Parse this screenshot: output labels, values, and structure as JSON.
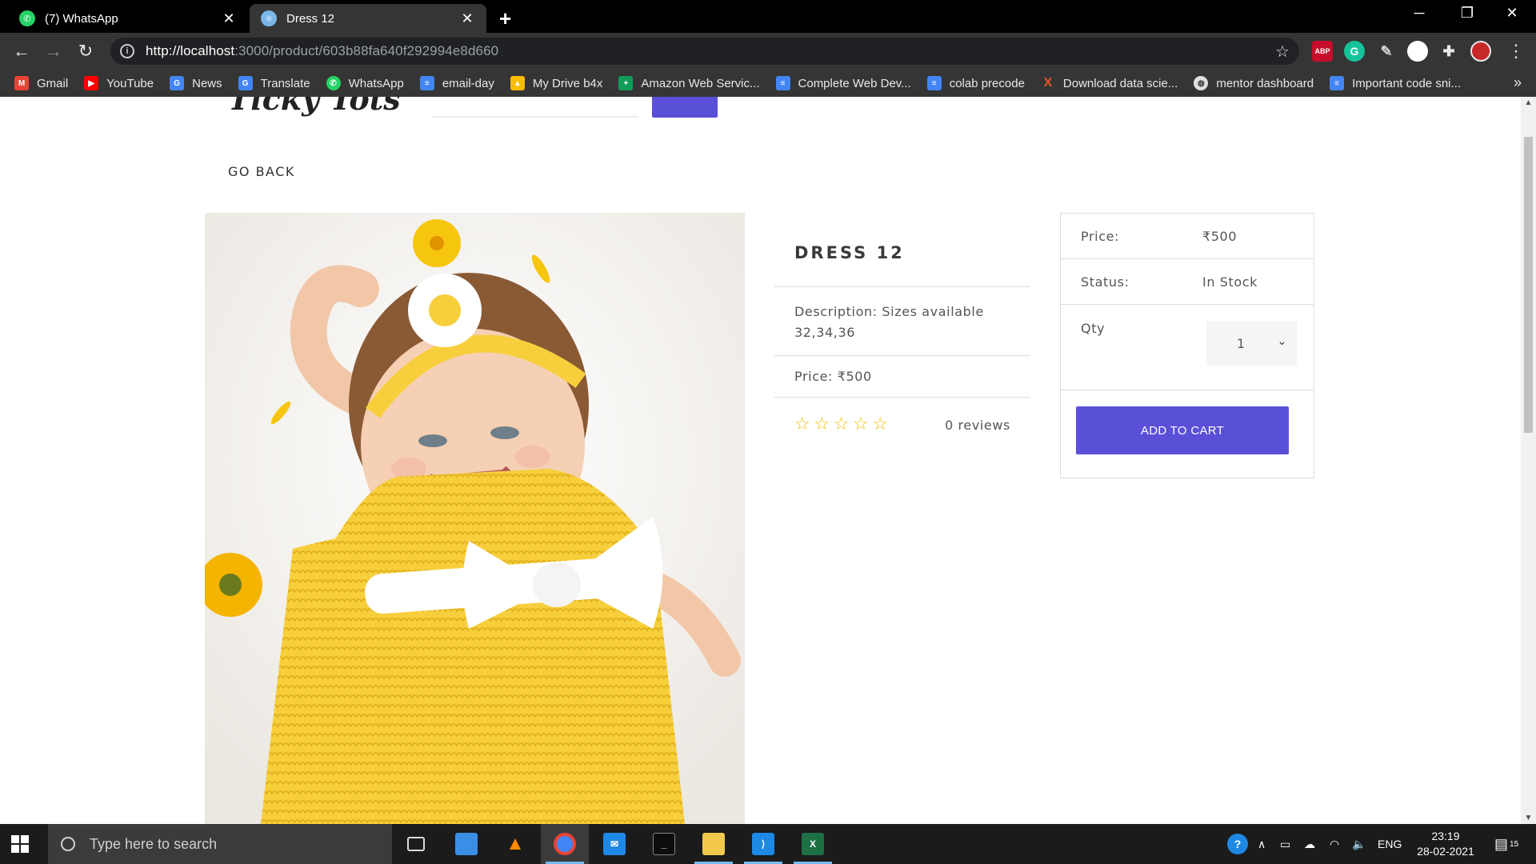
{
  "browser": {
    "tabs": [
      {
        "title": "(7) WhatsApp",
        "active": false,
        "icon": "whatsapp-icon"
      },
      {
        "title": "Dress 12",
        "active": true,
        "icon": "react-icon"
      }
    ],
    "url_host": "http://localhost",
    "url_rest": ":3000/product/603b88fa640f292994e8d660",
    "bookmarks": [
      {
        "label": "Gmail",
        "icon": "gmail-icon",
        "color": "#ea4335"
      },
      {
        "label": "YouTube",
        "icon": "youtube-icon",
        "color": "#ff0000"
      },
      {
        "label": "News",
        "icon": "news-icon",
        "color": "#4285f4"
      },
      {
        "label": "Translate",
        "icon": "translate-icon",
        "color": "#4285f4"
      },
      {
        "label": "WhatsApp",
        "icon": "whatsapp-icon",
        "color": "#25d366"
      },
      {
        "label": "email-day",
        "icon": "docs-icon",
        "color": "#4285f4"
      },
      {
        "label": "My Drive b4x",
        "icon": "drive-icon",
        "color": "#fbbc04"
      },
      {
        "label": "Amazon Web Servic...",
        "icon": "sheets-icon",
        "color": "#0f9d58"
      },
      {
        "label": "Complete Web Dev...",
        "icon": "docs-icon",
        "color": "#4285f4"
      },
      {
        "label": "colab precode",
        "icon": "docs-icon",
        "color": "#4285f4"
      },
      {
        "label": "Download data scie...",
        "icon": "x-icon",
        "color": "#e8532a"
      },
      {
        "label": "mentor dashboard",
        "icon": "globe-icon",
        "color": "#9e9e9e"
      },
      {
        "label": "Important code sni...",
        "icon": "docs-icon",
        "color": "#4285f4"
      }
    ],
    "bookmarks_more": "»",
    "extensions": [
      {
        "name": "adblock-icon",
        "text": "ABP",
        "color": "#c70d2c"
      },
      {
        "name": "grammarly-icon",
        "text": "G",
        "color": "#15c39a"
      },
      {
        "name": "color-picker-icon",
        "text": "",
        "color": "#9c27b0"
      },
      {
        "name": "profile-avatar-icon",
        "text": "",
        "color": "#ffffff"
      },
      {
        "name": "extensions-puzzle-icon",
        "text": "",
        "color": "#353535"
      },
      {
        "name": "account-avatar-icon",
        "text": "",
        "color": "#c62828"
      }
    ]
  },
  "site": {
    "brand": "Ticky Tots",
    "go_back": "GO BACK"
  },
  "product": {
    "name": "DRESS 12",
    "description": "Description: Sizes available 32,34,36",
    "price_line": "Price: ₹500",
    "reviews": "0 reviews",
    "rating": 0,
    "stars": [
      "☆",
      "☆",
      "☆",
      "☆",
      "☆"
    ]
  },
  "cart_card": {
    "price_label": "Price:",
    "price_value": "₹500",
    "status_label": "Status:",
    "status_value": "In Stock",
    "qty_label": "Qty",
    "qty_value": "1",
    "add_to_cart": "ADD TO CART"
  },
  "taskbar": {
    "search_placeholder": "Type here to search",
    "language": "ENG",
    "time": "23:19",
    "date": "28-02-2021",
    "notifications": "15"
  },
  "colors": {
    "accent": "#5a4fd7",
    "chrome_dark": "#353535",
    "taskbar": "#1b1b1b"
  }
}
